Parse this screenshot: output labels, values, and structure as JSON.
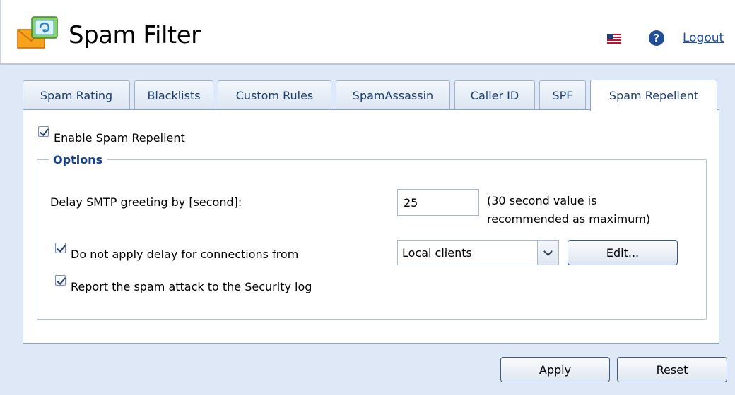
{
  "app": {
    "title": "Spam Filter",
    "logout_label": "Logout",
    "help_glyph": "?"
  },
  "icons": {
    "logo": "spam-envelope-icon",
    "flag": "us-flag-icon",
    "help": "help-icon"
  },
  "tabs": [
    {
      "label": "Spam Rating",
      "active": false
    },
    {
      "label": "Blacklists",
      "active": false
    },
    {
      "label": "Custom Rules",
      "active": false
    },
    {
      "label": "SpamAssassin",
      "active": false
    },
    {
      "label": "Caller ID",
      "active": false
    },
    {
      "label": "SPF",
      "active": false
    },
    {
      "label": "Spam Repellent",
      "active": true
    }
  ],
  "enable": {
    "label": "Enable Spam Repellent",
    "checked": true
  },
  "options": {
    "legend": "Options",
    "delay_label": "Delay SMTP greeting by [second]:",
    "delay_value": "25",
    "delay_hint_line1": "(30 second value is",
    "delay_hint_line2": "recommended as maximum)",
    "no_delay_label": "Do not apply delay for connections from",
    "no_delay_checked": true,
    "connections_value": "Local clients",
    "edit_label": "Edit...",
    "report_label": "Report the spam attack to the Security log",
    "report_checked": true
  },
  "footer": {
    "apply_label": "Apply",
    "reset_label": "Reset"
  },
  "colors": {
    "accent": "#15428b",
    "tab_text": "#1b3f6e",
    "background": "#dfe8f6",
    "link": "#1d4fb1"
  }
}
